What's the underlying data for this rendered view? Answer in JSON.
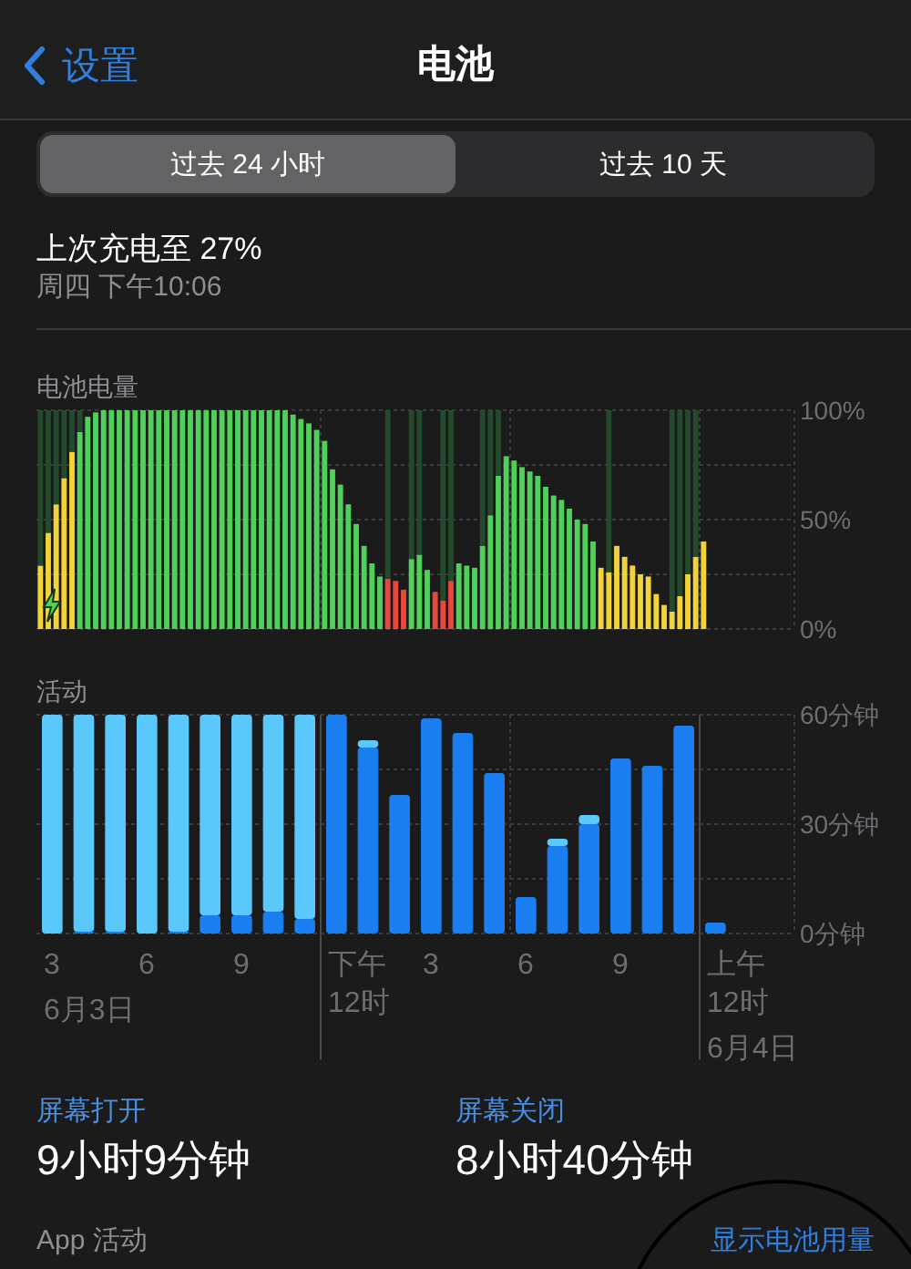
{
  "nav": {
    "back": "设置",
    "title": "电池"
  },
  "segments": [
    {
      "label": "过去 24 小时",
      "selected": true
    },
    {
      "label": "过去 10 天",
      "selected": false
    }
  ],
  "last_charge": {
    "title": "上次充电至 27%",
    "time": "周四 下午10:06"
  },
  "battery_level": {
    "title": "电池电量",
    "chart_data": {
      "type": "bar",
      "stacked": true,
      "ylim": [
        0,
        100
      ],
      "yticks": [
        {
          "value": 0,
          "label": "0%"
        },
        {
          "value": 50,
          "label": "50%"
        },
        {
          "value": 100,
          "label": "100%"
        }
      ],
      "series": [
        {
          "color": "#f2d43a",
          "values": [
            29,
            44,
            57,
            69,
            81,
            null,
            null,
            null,
            null,
            null,
            null,
            null,
            null,
            null,
            null,
            null,
            null,
            null,
            null,
            null,
            null,
            null,
            null,
            null,
            null,
            null,
            null,
            null,
            null,
            null,
            null,
            null,
            null,
            null,
            null,
            null,
            null,
            null,
            null,
            null,
            null,
            null,
            null,
            null,
            null,
            null,
            null,
            null,
            null,
            null,
            null,
            null,
            null,
            null,
            null,
            null,
            null,
            null,
            null,
            null,
            null,
            null,
            null,
            null,
            null,
            null,
            null,
            null,
            null,
            null,
            null,
            28,
            26,
            38,
            33,
            29,
            25,
            24,
            16,
            11,
            8,
            15,
            25,
            33,
            40,
            null,
            null,
            null,
            null,
            null,
            null,
            null,
            null,
            null,
            null,
            null
          ]
        },
        {
          "color": "#4fd05a",
          "values": [
            null,
            null,
            null,
            null,
            null,
            90,
            97,
            99,
            100,
            100,
            100,
            100,
            100,
            100,
            100,
            100,
            100,
            100,
            100,
            100,
            100,
            100,
            100,
            100,
            100,
            100,
            100,
            100,
            100,
            100,
            100,
            100,
            98,
            96,
            94,
            91,
            86,
            73,
            66,
            57,
            48,
            38,
            30,
            24,
            null,
            null,
            null,
            32,
            34,
            27,
            null,
            null,
            null,
            30,
            29,
            28,
            38,
            52,
            70,
            79,
            77,
            74,
            72,
            70,
            65,
            61,
            59,
            55,
            50,
            48,
            40,
            null,
            null,
            null,
            null,
            null,
            null,
            null,
            null,
            null,
            null,
            null,
            null,
            null,
            null,
            null,
            null,
            null,
            null,
            null,
            null,
            null,
            null,
            null,
            null,
            null
          ]
        },
        {
          "color": "#e8473c",
          "values": [
            null,
            null,
            null,
            null,
            null,
            null,
            null,
            null,
            null,
            null,
            null,
            null,
            null,
            null,
            null,
            null,
            null,
            null,
            null,
            null,
            null,
            null,
            null,
            null,
            null,
            null,
            null,
            null,
            null,
            null,
            null,
            null,
            null,
            null,
            null,
            null,
            null,
            null,
            null,
            null,
            null,
            null,
            null,
            null,
            23,
            22,
            18,
            null,
            null,
            null,
            17,
            13,
            22,
            null,
            null,
            null,
            null,
            null,
            null,
            null,
            null,
            null,
            null,
            null,
            null,
            null,
            null,
            null,
            null,
            null,
            null,
            null,
            null,
            null,
            null,
            null,
            null,
            null,
            null,
            null,
            null,
            null,
            null,
            null,
            null,
            null,
            null,
            null,
            null,
            null,
            null,
            null,
            null,
            null,
            null,
            null
          ]
        },
        {
          "color": "#234a2c",
          "values": [
            71,
            56,
            43,
            31,
            19,
            10,
            null,
            null,
            null,
            null,
            null,
            null,
            null,
            null,
            null,
            null,
            null,
            null,
            null,
            null,
            null,
            null,
            null,
            null,
            null,
            null,
            null,
            null,
            null,
            null,
            null,
            null,
            null,
            null,
            null,
            null,
            null,
            null,
            null,
            null,
            null,
            null,
            null,
            null,
            77,
            null,
            null,
            68,
            66,
            null,
            null,
            87,
            78,
            null,
            null,
            null,
            62,
            48,
            30,
            null,
            null,
            null,
            null,
            null,
            null,
            null,
            null,
            null,
            null,
            null,
            null,
            null,
            74,
            null,
            null,
            null,
            null,
            null,
            null,
            null,
            92,
            85,
            75,
            67,
            null,
            null,
            null,
            null,
            null,
            null,
            null,
            null,
            null,
            null,
            null,
            null
          ]
        }
      ]
    }
  },
  "activity": {
    "title": "活动",
    "time_labels": [
      "3",
      "6",
      "9",
      "下午\n12时",
      "3",
      "6",
      "9",
      "上午\n12时"
    ],
    "dates": [
      "6月3日",
      "6月4日"
    ],
    "chart_data": {
      "type": "bar",
      "stacked": true,
      "ylim": [
        0,
        60
      ],
      "yticks": [
        {
          "value": 0,
          "label": "0分钟"
        },
        {
          "value": 30,
          "label": "30分钟"
        },
        {
          "value": 60,
          "label": "60分钟"
        }
      ],
      "series": [
        {
          "color": "#1a7ef0",
          "values": [
            0,
            0.5,
            0.5,
            0,
            0.5,
            5,
            5,
            6,
            4,
            60,
            51,
            38,
            59,
            55,
            44,
            10,
            24,
            30,
            48,
            46,
            57,
            3,
            null,
            null
          ]
        },
        {
          "color": "#5ac8fa",
          "values": [
            60,
            59.5,
            59.5,
            60,
            59.5,
            55,
            55,
            54,
            56,
            0,
            2,
            0,
            0,
            0,
            0,
            0,
            2,
            2.5,
            0,
            0,
            0,
            0,
            null,
            null
          ]
        }
      ]
    }
  },
  "screen_time": [
    {
      "label": "屏幕打开",
      "value": "9小时9分钟"
    },
    {
      "label": "屏幕关闭",
      "value": "8小时40分钟"
    }
  ],
  "app_activity": {
    "title": "App 活动",
    "link": "显示电池用量"
  }
}
